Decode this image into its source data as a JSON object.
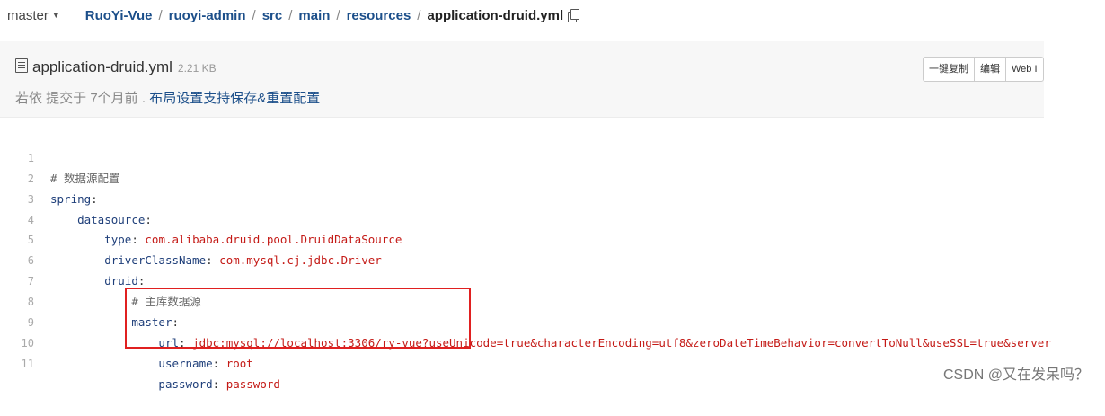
{
  "breadcrumb": {
    "branch": "master",
    "parts": [
      "RuoYi-Vue",
      "ruoyi-admin",
      "src",
      "main",
      "resources"
    ],
    "current": "application-druid.yml"
  },
  "file": {
    "name": "application-druid.yml",
    "size": "2.21 KB",
    "commit_prefix": "若依 提交于 7个月前 .",
    "commit_message": "布局设置支持保存&重置配置",
    "buttons": [
      "一键复制",
      "编辑",
      "Web I"
    ]
  },
  "code_lines": [
    {
      "num": "1",
      "indent": "",
      "comment": "# 数据源配置"
    },
    {
      "num": "2",
      "indent": "",
      "key": "spring",
      "colon": ":"
    },
    {
      "num": "3",
      "indent": "    ",
      "key": "datasource",
      "colon": ":"
    },
    {
      "num": "4",
      "indent": "        ",
      "key": "type",
      "colon": ": ",
      "value": "com.alibaba.druid.pool.DruidDataSource"
    },
    {
      "num": "5",
      "indent": "        ",
      "key": "driverClassName",
      "colon": ": ",
      "value": "com.mysql.cj.jdbc.Driver"
    },
    {
      "num": "6",
      "indent": "        ",
      "key": "druid",
      "colon": ":"
    },
    {
      "num": "7",
      "indent": "            ",
      "comment": "# 主库数据源"
    },
    {
      "num": "8",
      "indent": "            ",
      "key": "master",
      "colon": ":"
    },
    {
      "num": "9",
      "indent": "                ",
      "key": "url",
      "colon": ": ",
      "value": "jdbc:mysql://localhost:3306/ry-vue?useUnicode=true&characterEncoding=utf8&zeroDateTimeBehavior=convertToNull&useSSL=true&server"
    },
    {
      "num": "10",
      "indent": "                ",
      "key": "username",
      "colon": ": ",
      "value": "root"
    },
    {
      "num": "11",
      "indent": "                ",
      "key": "password",
      "colon": ": ",
      "value": "password"
    }
  ],
  "watermark": "CSDN @又在发呆吗？",
  "colors": {
    "link": "#1c4f8a",
    "key": "#1f3f7a",
    "value": "#c41a16",
    "highlight_border": "#e02020",
    "panel_bg": "#f7f7f7"
  }
}
